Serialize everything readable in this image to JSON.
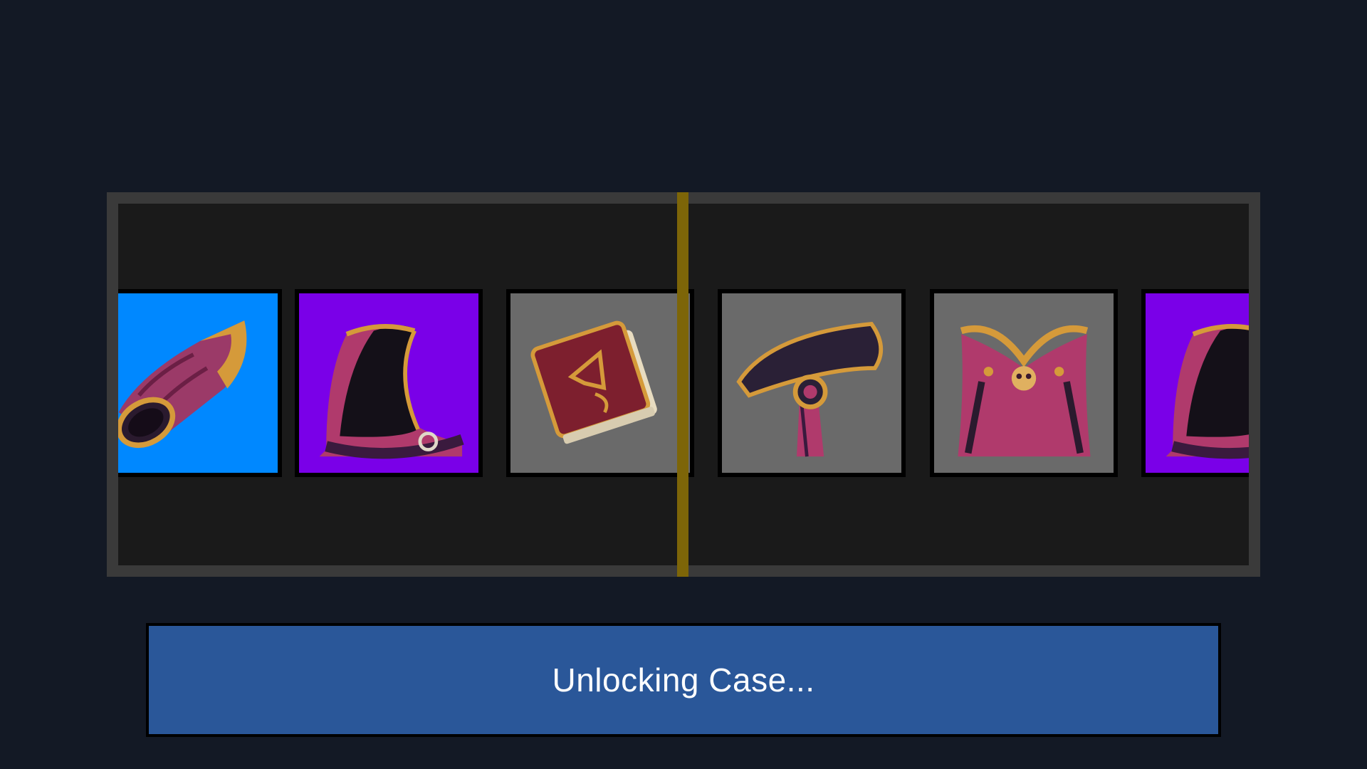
{
  "theme": {
    "background": "#131925",
    "frame": "#3a3a3a",
    "window": "#1a1a1a",
    "indicator": "#7d6508",
    "button": "#2a5799",
    "rarity_blue": "#0088ff",
    "rarity_purple": "#7a00e8",
    "rarity_gray": "#6a6a6a"
  },
  "case": {
    "items": [
      {
        "icon": "bracer-icon",
        "rarity_color": "#0088ff"
      },
      {
        "icon": "hood-icon",
        "rarity_color": "#7a00e8"
      },
      {
        "icon": "spellbook-icon",
        "rarity_color": "#6a6a6a"
      },
      {
        "icon": "belt-icon",
        "rarity_color": "#6a6a6a"
      },
      {
        "icon": "skull-cape-icon",
        "rarity_color": "#6a6a6a"
      },
      {
        "icon": "hood-icon",
        "rarity_color": "#7a00e8"
      }
    ]
  },
  "button": {
    "label": "Unlocking Case..."
  }
}
